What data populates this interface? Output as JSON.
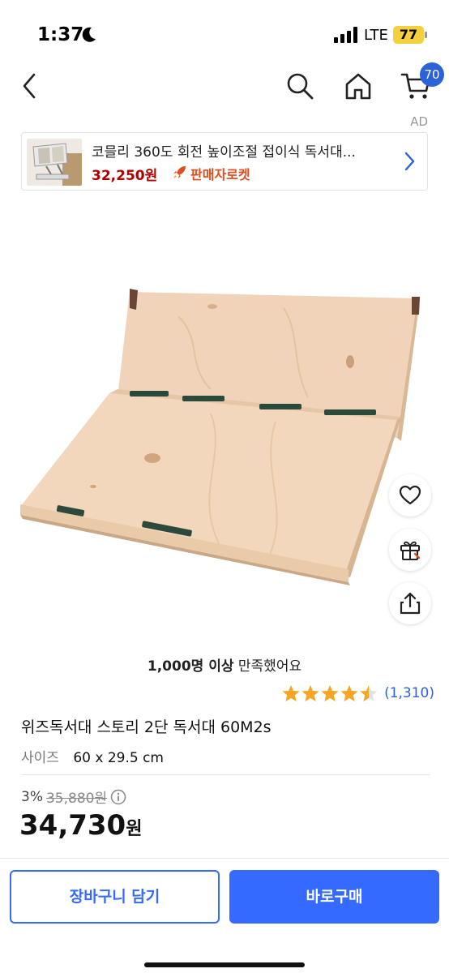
{
  "status_bar": {
    "time": "1:37",
    "network": "LTE",
    "battery": "77"
  },
  "nav": {
    "cart_count": "70"
  },
  "ad": {
    "label": "AD",
    "title": "코믈리 360도 회전 높이조절 접이식 독서대...",
    "price": "32,250원",
    "rocket_label": "판매자로켓"
  },
  "product": {
    "satisfied_bold": "1,000명 이상",
    "satisfied_text": " 만족했어요",
    "rating": 4.5,
    "review_count": "(1,310)",
    "title": "위즈독서대 스토리 2단 독서대 60M2s",
    "option_label": "사이즈",
    "option_value": "60 x 29.5 cm",
    "discount_rate": "3%",
    "original_price": "35,880원",
    "final_price": "34,730",
    "currency": "원"
  },
  "bottom": {
    "cart_button": "장바구니 담기",
    "buy_button": "바로구매"
  },
  "colors": {
    "accent": "#346aff",
    "badge": "#2a62d9",
    "ad_price": "#ae0000",
    "rocket": "#e24b1b",
    "star": "#f5a623"
  }
}
